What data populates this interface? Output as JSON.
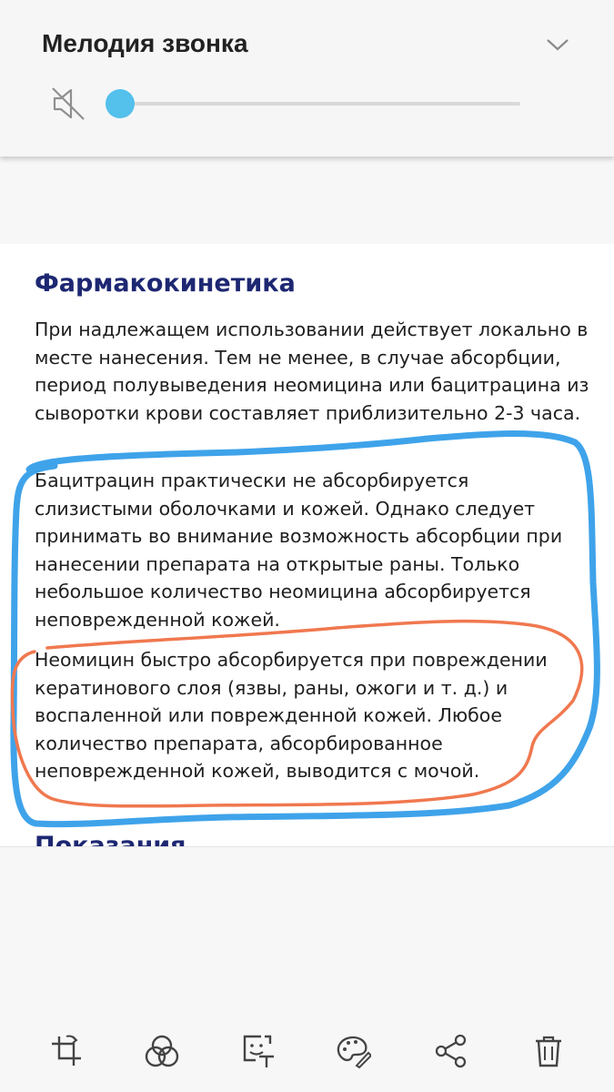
{
  "volume_panel": {
    "title": "Мелодия звонка",
    "level": 0.03,
    "accent_color": "#54c0ec",
    "mute_icon": "speaker-muted-icon",
    "expand_icon": "chevron-down-icon"
  },
  "article": {
    "section_title": "Фармакокинетика",
    "paragraphs": [
      "При надлежащем использовании действует локально в месте нанесения. Тем не менее, в случае абсорбции, период полувыведения неомицина или бацитрацина из сыворотки крови составляет приблизительно 2-3 часа.",
      "Бацитрацин практически не абсорбируется слизистыми оболочками и кожей. Однако следует принимать во внимание возможность абсорбции при нанесении препарата на открытые раны. Только небольшое количество неомицина абсорбируется неповрежденной кожей.",
      "Неомицин быстро абсорбируется при повреждении кератинового слоя (язвы, раны, ожоги и т. д.) и воспаленной или поврежденной кожей. Любое количество препарата, абсорбированное неповрежденной кожей, выводится с мочой."
    ],
    "next_section_title": "Показания",
    "title_color": "#1d2772"
  },
  "annotations": {
    "blue_stroke_color": "#3fa3ea",
    "orange_stroke_color": "#f0784f"
  },
  "toolbar": {
    "tools": [
      {
        "name": "rotate-crop-icon"
      },
      {
        "name": "filter-circles-icon"
      },
      {
        "name": "sticker-text-icon"
      },
      {
        "name": "draw-palette-icon"
      },
      {
        "name": "share-icon"
      },
      {
        "name": "delete-icon"
      }
    ]
  }
}
